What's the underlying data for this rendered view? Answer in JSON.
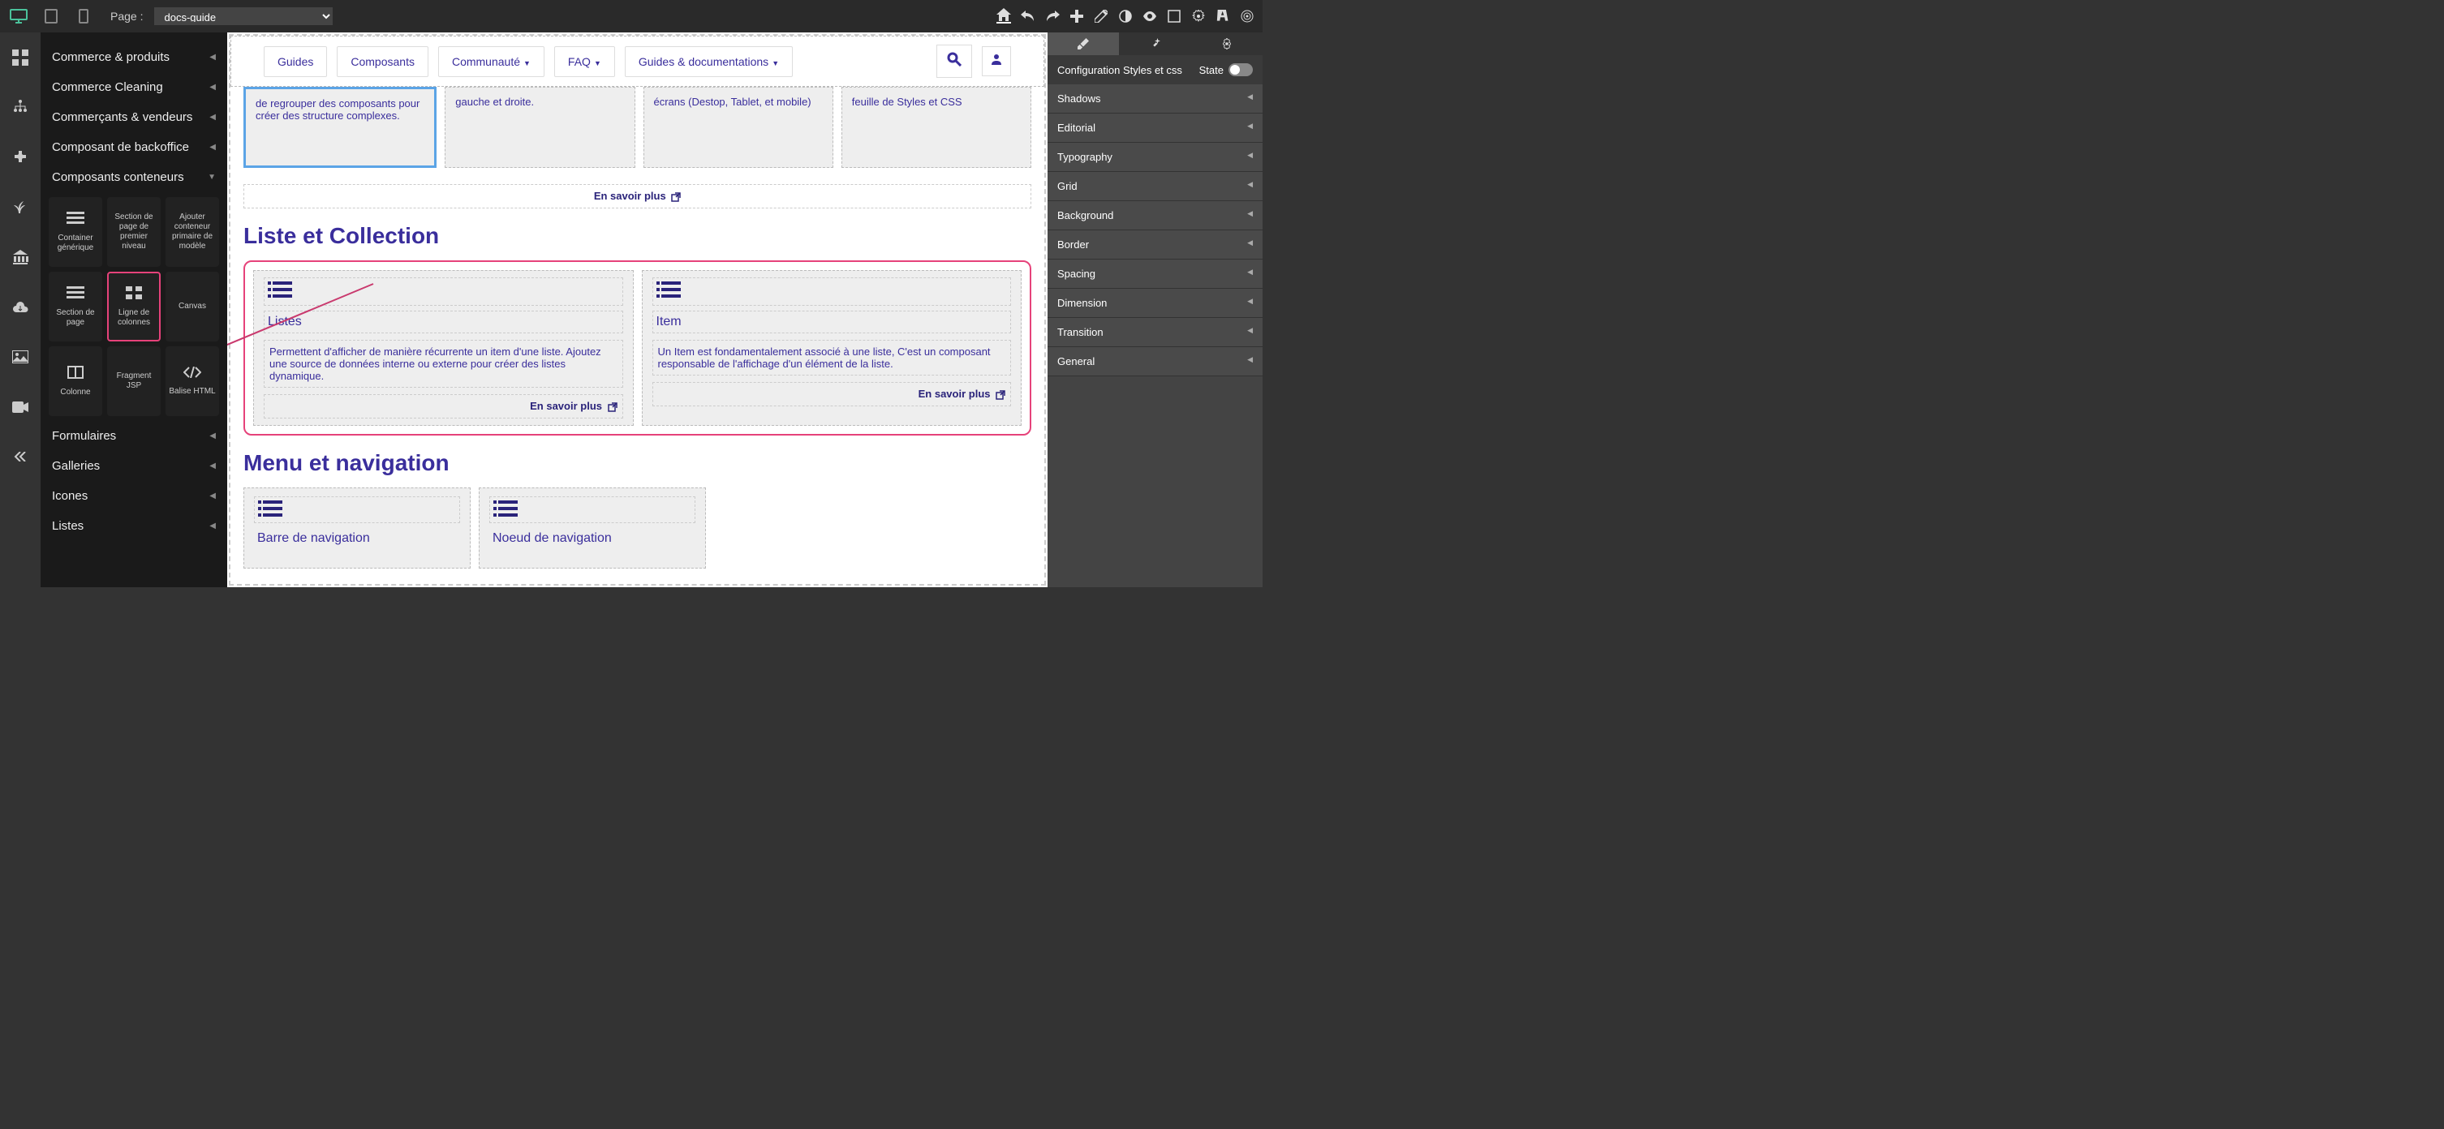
{
  "topbar": {
    "page_label": "Page :",
    "page_value": "docs-guide"
  },
  "sidebar": {
    "items": [
      "Commerce & produits",
      "Commerce Cleaning",
      "Commerçants & vendeurs",
      "Composant de backoffice",
      "Composants conteneurs",
      "Formulaires",
      "Galleries",
      "Icones",
      "Listes"
    ],
    "components": [
      {
        "label": "Container générique"
      },
      {
        "label": "Section de page de premier niveau"
      },
      {
        "label": "Ajouter conteneur primaire de modèle"
      },
      {
        "label": "Section de page"
      },
      {
        "label": "Ligne de colonnes"
      },
      {
        "label": "Canvas"
      },
      {
        "label": "Colonne"
      },
      {
        "label": "Fragment JSP"
      },
      {
        "label": "Balise HTML"
      }
    ]
  },
  "page_nav": {
    "items": [
      "Guides",
      "Composants",
      "Communauté",
      "FAQ",
      "Guides & documentations"
    ]
  },
  "cards_top": [
    {
      "text": "de regrouper des composants pour créer des structure complexes."
    },
    {
      "text": "gauche et droite."
    },
    {
      "text": "écrans (Destop, Tablet, et mobile)"
    },
    {
      "text": "feuille de Styles et CSS"
    }
  ],
  "learn_more": "En savoir plus",
  "section_liste": {
    "title": "Liste et Collection",
    "cards": [
      {
        "title": "Listes",
        "body": "Permettent d'afficher de manière récurrente un item d'une liste. Ajoutez une source de données interne ou externe pour créer des listes dynamique."
      },
      {
        "title": "Item",
        "body": "Un Item est fondamentalement associé à une liste, C'est un composant responsable de l'affichage d'un élément de la liste."
      }
    ]
  },
  "section_menu": {
    "title": "Menu et navigation",
    "cards": [
      {
        "title": "Barre de navigation"
      },
      {
        "title": "Noeud de navigation"
      }
    ]
  },
  "right_panel": {
    "config_label": "Configuration Styles et css",
    "state_label": "State",
    "props": [
      "Shadows",
      "Editorial",
      "Typography",
      "Grid",
      "Background",
      "Border",
      "Spacing",
      "Dimension",
      "Transition",
      "General"
    ]
  }
}
